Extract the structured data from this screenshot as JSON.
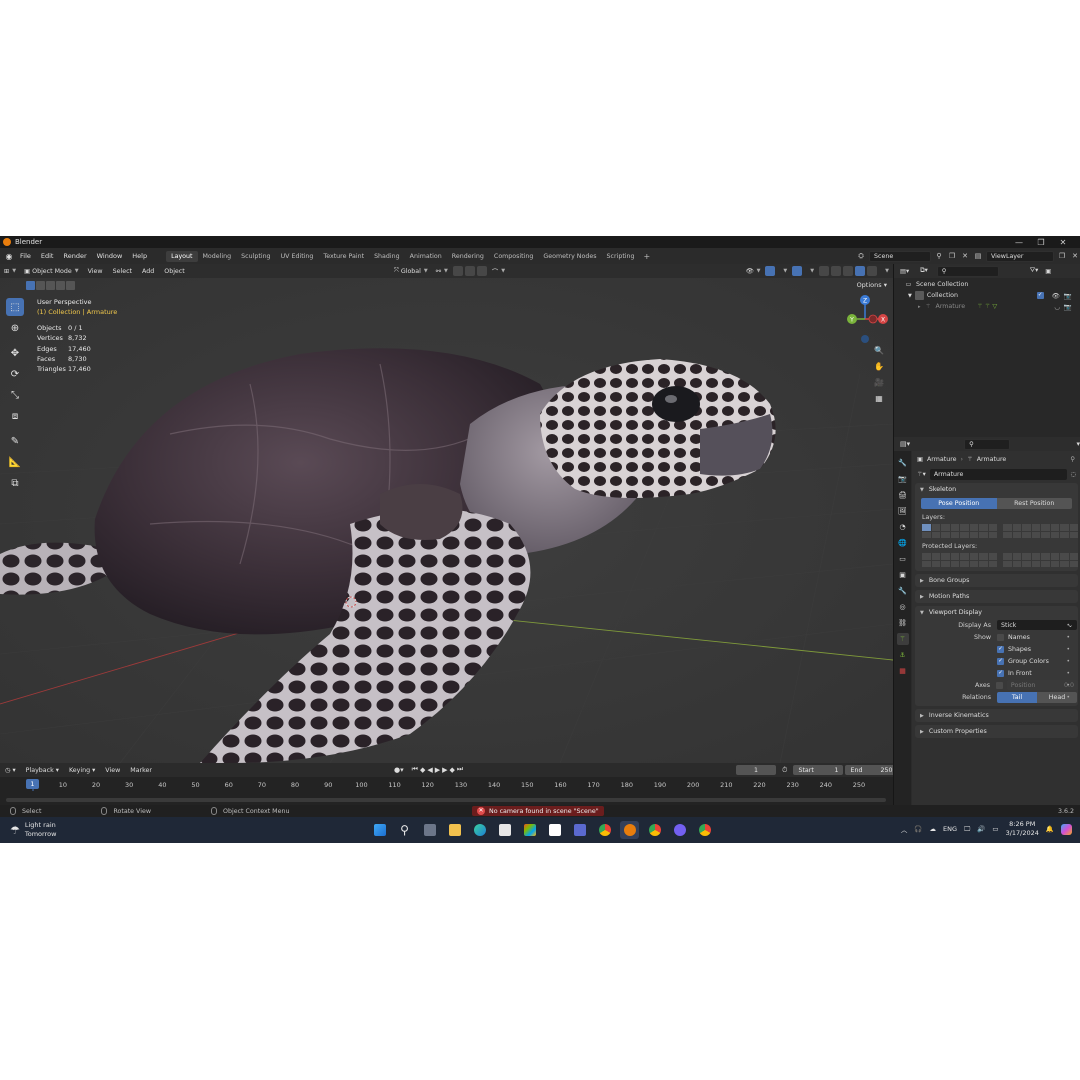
{
  "app": {
    "title": "Blender",
    "version": "3.6.2"
  },
  "menu": [
    "File",
    "Edit",
    "Render",
    "Window",
    "Help"
  ],
  "workspaces": [
    {
      "label": "Layout",
      "active": true
    },
    {
      "label": "Modeling"
    },
    {
      "label": "Sculpting"
    },
    {
      "label": "UV Editing"
    },
    {
      "label": "Texture Paint"
    },
    {
      "label": "Shading"
    },
    {
      "label": "Animation"
    },
    {
      "label": "Rendering"
    },
    {
      "label": "Compositing"
    },
    {
      "label": "Geometry Nodes"
    },
    {
      "label": "Scripting"
    }
  ],
  "workspace_add": "+",
  "scene": {
    "name": "Scene",
    "view_layer": "ViewLayer"
  },
  "viewport": {
    "mode": "Object Mode",
    "menus": [
      "View",
      "Select",
      "Add",
      "Object"
    ],
    "orientation": "Global",
    "options": "Options",
    "perspective": "User Perspective",
    "collection_label": "(1) Collection | Armature",
    "stats": [
      {
        "key": "Objects",
        "value": "0 / 1"
      },
      {
        "key": "Vertices",
        "value": "8,732"
      },
      {
        "key": "Edges",
        "value": "17,460"
      },
      {
        "key": "Faces",
        "value": "8,730"
      },
      {
        "key": "Triangles",
        "value": "17,460"
      }
    ],
    "gizmo": {
      "x": "X",
      "y": "Y",
      "z": "Z"
    }
  },
  "timeline": {
    "menus": [
      "Playback",
      "Keying",
      "View",
      "Marker"
    ],
    "current_frame": "1",
    "start_label": "Start",
    "start": "1",
    "end_label": "End",
    "end": "250",
    "ticks": [
      "1",
      "10",
      "20",
      "30",
      "40",
      "50",
      "60",
      "70",
      "80",
      "90",
      "100",
      "110",
      "120",
      "130",
      "140",
      "150",
      "160",
      "170",
      "180",
      "190",
      "200",
      "210",
      "220",
      "230",
      "240",
      "250"
    ]
  },
  "statusbar": {
    "select": "Select",
    "rotate": "Rotate View",
    "context": "Object Context Menu",
    "warning": "No camera found in scene \"Scene\""
  },
  "outliner": {
    "scene_collection": "Scene Collection",
    "collection": "Collection",
    "armature": "Armature"
  },
  "properties": {
    "breadcrumb_object": "Armature",
    "breadcrumb_data": "Armature",
    "data_name": "Armature",
    "skeleton": {
      "title": "Skeleton",
      "pose_position": "Pose Position",
      "rest_position": "Rest Position",
      "layers_label": "Layers:",
      "protected_label": "Protected Layers:"
    },
    "bone_groups": "Bone Groups",
    "motion_paths": "Motion Paths",
    "viewport_display": {
      "title": "Viewport Display",
      "display_as_label": "Display As",
      "display_as": "Stick",
      "show_label": "Show",
      "names": "Names",
      "shapes": "Shapes",
      "group_colors": "Group Colors",
      "in_front": "In Front",
      "axes_label": "Axes",
      "position_label": "Position",
      "position_value": "0.0",
      "relations_label": "Relations",
      "tail": "Tail",
      "head": "Head"
    },
    "inverse_kinematics": "Inverse Kinematics",
    "custom_properties": "Custom Properties"
  },
  "taskbar": {
    "weather_title": "Light rain",
    "weather_sub": "Tomorrow",
    "language": "ENG",
    "time": "8:26 PM",
    "date": "3/17/2024"
  },
  "colors": {
    "accent": "#4772b3",
    "viewport_bg": "#393939",
    "collection_text": "#f2c94c",
    "warning": "#6b1d1d"
  }
}
